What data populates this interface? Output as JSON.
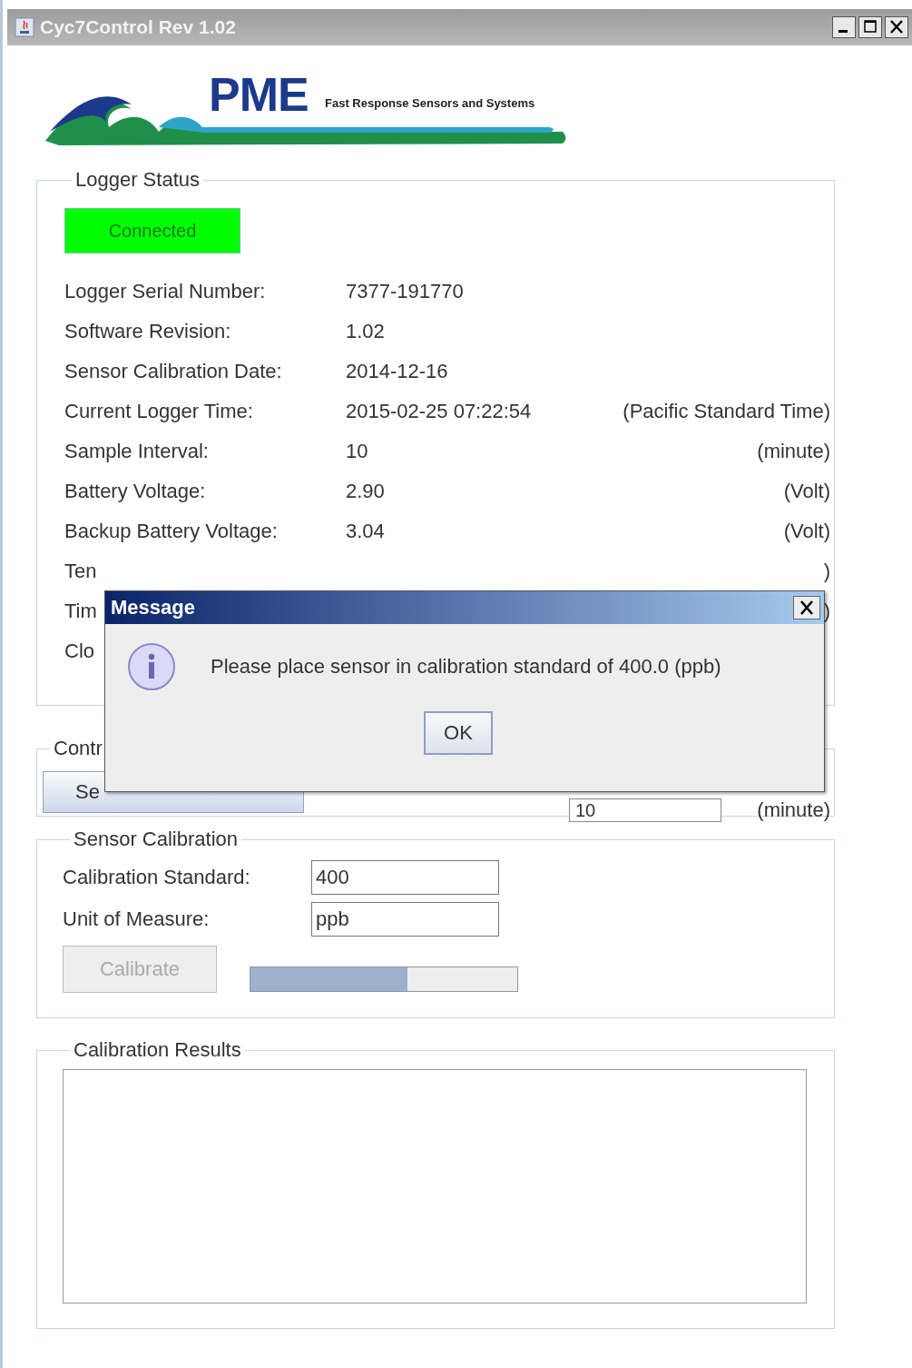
{
  "window": {
    "title": "Cyc7Control Rev 1.02"
  },
  "logo": {
    "name": "PME",
    "tagline": "Fast Response Sensors and Systems"
  },
  "logger_status": {
    "title": "Logger Status",
    "connection": {
      "label": "Connected",
      "connected": true
    },
    "rows": [
      {
        "label": "Logger Serial Number:",
        "value": "7377-191770"
      },
      {
        "label": "Software Revision:",
        "value": "1.02"
      },
      {
        "label": "Sensor Calibration Date:",
        "value": "2014-12-16"
      },
      {
        "label": "Current Logger Time:",
        "value": "2015-02-25 07:22:54",
        "unit": "(Pacific Standard Time)"
      },
      {
        "label": "Sample Interval:",
        "value": "10",
        "unit": "(minute)"
      },
      {
        "label": "Battery Voltage:",
        "value": "2.90",
        "unit": "(Volt)"
      },
      {
        "label": "Backup Battery Voltage:",
        "value": "3.04",
        "unit": "(Volt)"
      },
      {
        "label": "Ten",
        "unit": ")"
      },
      {
        "label": "Tim",
        "unit": ")"
      },
      {
        "label": "Clo"
      }
    ]
  },
  "control": {
    "title": "Contr",
    "button": "Se",
    "field_value": "10",
    "unit": "(minute)"
  },
  "sensor_calibration": {
    "title": "Sensor Calibration",
    "fields": [
      {
        "label": "Calibration Standard:",
        "value": "400"
      },
      {
        "label": "Unit of Measure:",
        "value": "ppb"
      }
    ],
    "calibrate_button": {
      "label": "Calibrate",
      "disabled": true
    },
    "progress": {
      "level": 0.59
    }
  },
  "calibration_results": {
    "title": "Calibration Results"
  },
  "dialog": {
    "title": "Message",
    "message": "Please place sensor in calibration standard of 400.0 (ppb)",
    "button": "OK"
  }
}
